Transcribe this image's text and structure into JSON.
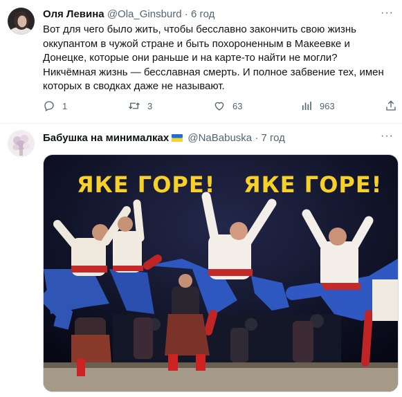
{
  "tweet1": {
    "name": "Оля Левина",
    "handle": "@Ola_Ginsburd",
    "separator": "·",
    "time": "6 год",
    "text": "Вот для чего было жить, чтобы бесславно закончить свою жизнь оккупантом в чужой стране и быть похороненным в Макеевке и Донецке, которые они раньше и на карте-то найти не могли?\nНикчёмная жизнь — бесславная смерть. И полное забвение тех, имен которых в сводках даже не называют.",
    "more": "···",
    "actions": {
      "replies": "1",
      "retweets": "3",
      "likes": "63",
      "views": "963"
    }
  },
  "tweet2": {
    "name": "Бабушка на минималках",
    "handle": "@NaBabuska",
    "separator": "·",
    "time": "7 год",
    "more": "···",
    "flag_icon": "ukraine-flag-icon",
    "media": {
      "caption_left": "ЯКЕ ГОРЕ!",
      "caption_right": "ЯКЕ ГОРЕ!"
    }
  },
  "colors": {
    "text": "#0f1419",
    "secondary": "#536471",
    "caption": "#f7d02a",
    "stage_bg": "#0d1024"
  }
}
